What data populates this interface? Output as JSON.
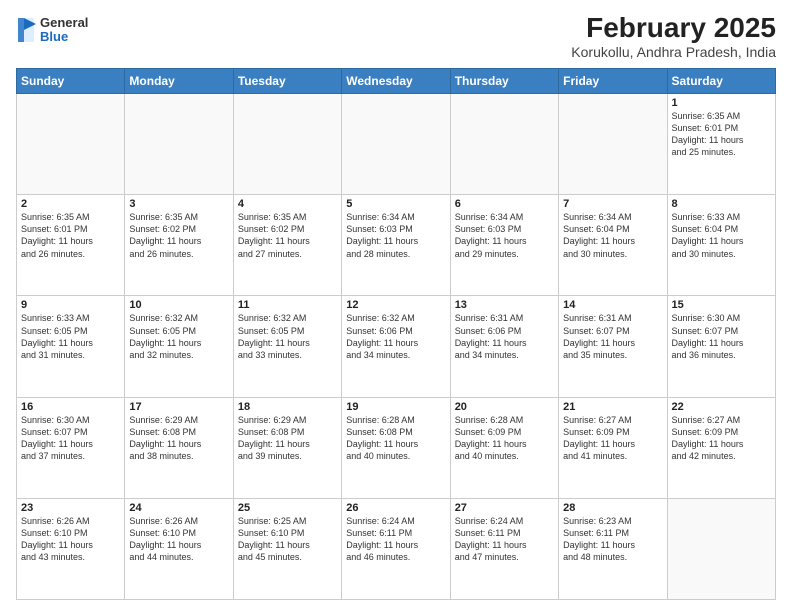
{
  "header": {
    "logo_general": "General",
    "logo_blue": "Blue",
    "title": "February 2025",
    "subtitle": "Korukollu, Andhra Pradesh, India"
  },
  "days_of_week": [
    "Sunday",
    "Monday",
    "Tuesday",
    "Wednesday",
    "Thursday",
    "Friday",
    "Saturday"
  ],
  "weeks": [
    [
      {
        "day": "",
        "info": ""
      },
      {
        "day": "",
        "info": ""
      },
      {
        "day": "",
        "info": ""
      },
      {
        "day": "",
        "info": ""
      },
      {
        "day": "",
        "info": ""
      },
      {
        "day": "",
        "info": ""
      },
      {
        "day": "1",
        "info": "Sunrise: 6:35 AM\nSunset: 6:01 PM\nDaylight: 11 hours\nand 25 minutes."
      }
    ],
    [
      {
        "day": "2",
        "info": "Sunrise: 6:35 AM\nSunset: 6:01 PM\nDaylight: 11 hours\nand 26 minutes."
      },
      {
        "day": "3",
        "info": "Sunrise: 6:35 AM\nSunset: 6:02 PM\nDaylight: 11 hours\nand 26 minutes."
      },
      {
        "day": "4",
        "info": "Sunrise: 6:35 AM\nSunset: 6:02 PM\nDaylight: 11 hours\nand 27 minutes."
      },
      {
        "day": "5",
        "info": "Sunrise: 6:34 AM\nSunset: 6:03 PM\nDaylight: 11 hours\nand 28 minutes."
      },
      {
        "day": "6",
        "info": "Sunrise: 6:34 AM\nSunset: 6:03 PM\nDaylight: 11 hours\nand 29 minutes."
      },
      {
        "day": "7",
        "info": "Sunrise: 6:34 AM\nSunset: 6:04 PM\nDaylight: 11 hours\nand 30 minutes."
      },
      {
        "day": "8",
        "info": "Sunrise: 6:33 AM\nSunset: 6:04 PM\nDaylight: 11 hours\nand 30 minutes."
      }
    ],
    [
      {
        "day": "9",
        "info": "Sunrise: 6:33 AM\nSunset: 6:05 PM\nDaylight: 11 hours\nand 31 minutes."
      },
      {
        "day": "10",
        "info": "Sunrise: 6:32 AM\nSunset: 6:05 PM\nDaylight: 11 hours\nand 32 minutes."
      },
      {
        "day": "11",
        "info": "Sunrise: 6:32 AM\nSunset: 6:05 PM\nDaylight: 11 hours\nand 33 minutes."
      },
      {
        "day": "12",
        "info": "Sunrise: 6:32 AM\nSunset: 6:06 PM\nDaylight: 11 hours\nand 34 minutes."
      },
      {
        "day": "13",
        "info": "Sunrise: 6:31 AM\nSunset: 6:06 PM\nDaylight: 11 hours\nand 34 minutes."
      },
      {
        "day": "14",
        "info": "Sunrise: 6:31 AM\nSunset: 6:07 PM\nDaylight: 11 hours\nand 35 minutes."
      },
      {
        "day": "15",
        "info": "Sunrise: 6:30 AM\nSunset: 6:07 PM\nDaylight: 11 hours\nand 36 minutes."
      }
    ],
    [
      {
        "day": "16",
        "info": "Sunrise: 6:30 AM\nSunset: 6:07 PM\nDaylight: 11 hours\nand 37 minutes."
      },
      {
        "day": "17",
        "info": "Sunrise: 6:29 AM\nSunset: 6:08 PM\nDaylight: 11 hours\nand 38 minutes."
      },
      {
        "day": "18",
        "info": "Sunrise: 6:29 AM\nSunset: 6:08 PM\nDaylight: 11 hours\nand 39 minutes."
      },
      {
        "day": "19",
        "info": "Sunrise: 6:28 AM\nSunset: 6:08 PM\nDaylight: 11 hours\nand 40 minutes."
      },
      {
        "day": "20",
        "info": "Sunrise: 6:28 AM\nSunset: 6:09 PM\nDaylight: 11 hours\nand 40 minutes."
      },
      {
        "day": "21",
        "info": "Sunrise: 6:27 AM\nSunset: 6:09 PM\nDaylight: 11 hours\nand 41 minutes."
      },
      {
        "day": "22",
        "info": "Sunrise: 6:27 AM\nSunset: 6:09 PM\nDaylight: 11 hours\nand 42 minutes."
      }
    ],
    [
      {
        "day": "23",
        "info": "Sunrise: 6:26 AM\nSunset: 6:10 PM\nDaylight: 11 hours\nand 43 minutes."
      },
      {
        "day": "24",
        "info": "Sunrise: 6:26 AM\nSunset: 6:10 PM\nDaylight: 11 hours\nand 44 minutes."
      },
      {
        "day": "25",
        "info": "Sunrise: 6:25 AM\nSunset: 6:10 PM\nDaylight: 11 hours\nand 45 minutes."
      },
      {
        "day": "26",
        "info": "Sunrise: 6:24 AM\nSunset: 6:11 PM\nDaylight: 11 hours\nand 46 minutes."
      },
      {
        "day": "27",
        "info": "Sunrise: 6:24 AM\nSunset: 6:11 PM\nDaylight: 11 hours\nand 47 minutes."
      },
      {
        "day": "28",
        "info": "Sunrise: 6:23 AM\nSunset: 6:11 PM\nDaylight: 11 hours\nand 48 minutes."
      },
      {
        "day": "",
        "info": ""
      }
    ]
  ]
}
